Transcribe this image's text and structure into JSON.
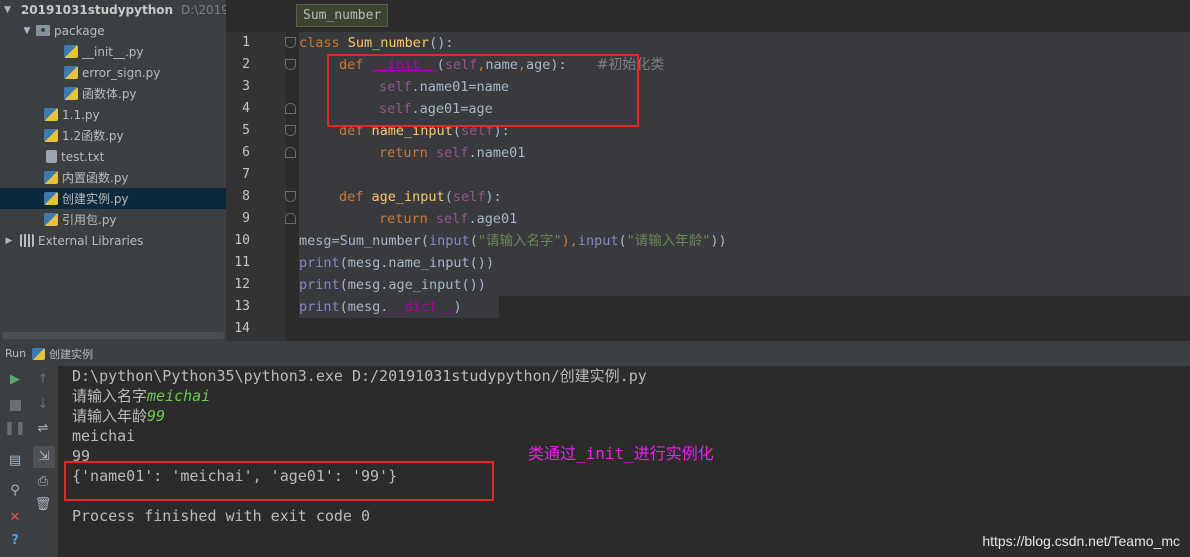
{
  "colors": {
    "highlight_box": "#e5272a",
    "annotation": "#ea21ea",
    "keyword": "#cc7832",
    "function": "#ffc66d",
    "self": "#94558d",
    "string": "#6a8759",
    "builtin": "#8888c6",
    "input_echo": "#6ecb4f"
  },
  "project": {
    "root": {
      "label": "20191031studypython",
      "path": "D:\\2019"
    },
    "items": [
      {
        "label": "package",
        "icon": "folder-icon"
      },
      {
        "label": "__init__.py",
        "icon": "python-file-icon"
      },
      {
        "label": "error_sign.py",
        "icon": "python-file-icon"
      },
      {
        "label": "函数体.py",
        "icon": "python-file-icon"
      },
      {
        "label": "1.1.py",
        "icon": "python-file-icon"
      },
      {
        "label": "1.2函数.py",
        "icon": "python-file-icon"
      },
      {
        "label": "test.txt",
        "icon": "text-file-icon"
      },
      {
        "label": "内置函数.py",
        "icon": "python-file-icon"
      },
      {
        "label": "创建实例.py",
        "icon": "python-file-icon",
        "selected": true
      },
      {
        "label": "引用包.py",
        "icon": "python-file-icon"
      },
      {
        "label": "External Libraries",
        "icon": "library-icon"
      }
    ]
  },
  "editor": {
    "breadcrumb": "Sum_number",
    "line_numbers": [
      "1",
      "2",
      "3",
      "4",
      "5",
      "6",
      "7",
      "8",
      "9",
      "10",
      "11",
      "12",
      "13",
      "14"
    ],
    "tokens": {
      "l1": [
        "class",
        " ",
        "Sum_number",
        "():"
      ],
      "l2": [
        "def",
        " ",
        "__init__",
        "(",
        "self",
        ",",
        "name",
        ",",
        "age",
        "):",
        "#初始化类"
      ],
      "l3": [
        "self",
        ".name01=",
        "name"
      ],
      "l4": [
        "self",
        ".age01=",
        "age"
      ],
      "l5": [
        "def",
        " ",
        "name_input",
        "(",
        "self",
        "):"
      ],
      "l6": [
        "return",
        " ",
        "self",
        ".name01"
      ],
      "l8": [
        "def",
        " ",
        "age_input",
        "(",
        "self",
        "):"
      ],
      "l9": [
        "return",
        " ",
        "self",
        ".age01"
      ],
      "l10": [
        "mesg=Sum_number(",
        "input",
        "(",
        "\"请输入名字\"",
        "),",
        "input",
        "(",
        "\"请输入年龄\"",
        "))"
      ],
      "l11": [
        "print",
        "(mesg.name_input())"
      ],
      "l12": [
        "print",
        "(mesg.age_input())"
      ],
      "l13": [
        "print",
        "(mesg.",
        "__dict__",
        ")"
      ]
    }
  },
  "run": {
    "label": "Run",
    "config": "创建实例"
  },
  "console": {
    "command": "D:\\python\\Python35\\python3.exe D:/20191031studypython/创建实例.py",
    "prompt_name": "请输入名字",
    "input_name": "meichai",
    "prompt_age": "请输入年龄",
    "input_age": "99",
    "out1": "meichai",
    "out2": "99",
    "out3": "{'name01': 'meichai', 'age01': '99'}",
    "exit": "Process finished with exit code 0"
  },
  "annotation": "类通过_init_进行实例化",
  "watermark": "https://blog.csdn.net/Teamo_mc"
}
